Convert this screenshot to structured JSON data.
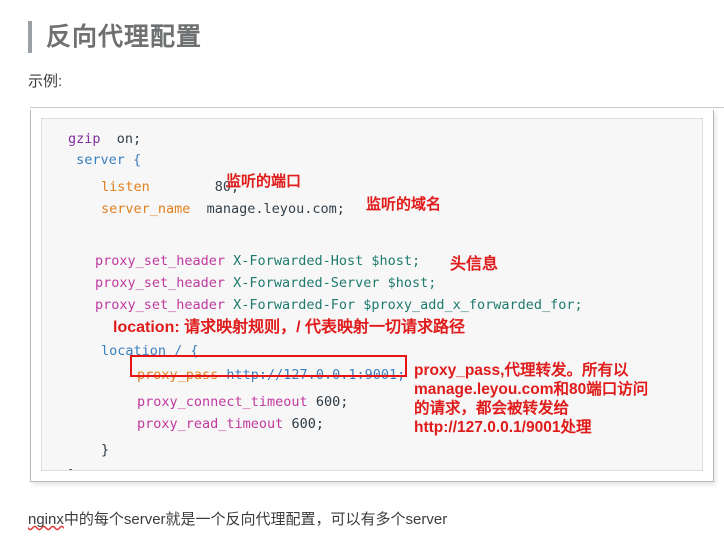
{
  "page": {
    "title": "反向代理配置",
    "example_label": "示例:",
    "footer": {
      "misspelled_word": "nginx",
      "rest": "中的每个server就是一个反向代理配置，可以有多个server"
    }
  },
  "code_block": {
    "language": "nginx",
    "lines": [
      {
        "indent": 1,
        "tokens": [
          {
            "text": "gzip",
            "color": "purple"
          },
          {
            "text": "  on;",
            "color": "plain"
          }
        ]
      },
      {
        "indent": 1,
        "tokens": [
          {
            "text": " server {",
            "color": "blue"
          }
        ]
      },
      {
        "indent": 2,
        "tokens": [
          {
            "text": "listen",
            "color": "orange"
          },
          {
            "text": "        80;",
            "color": "plain"
          }
        ]
      },
      {
        "indent": 2,
        "tokens": [
          {
            "text": "server_name",
            "color": "orange"
          },
          {
            "text": "  manage.leyou.com;",
            "color": "plain"
          }
        ]
      },
      {
        "indent": 0,
        "tokens": []
      },
      {
        "indent": 2,
        "tokens": [
          {
            "text": "proxy_set_header",
            "color": "magenta"
          },
          {
            "text": " X-Forwarded-Host $host;",
            "color": "teal"
          }
        ]
      },
      {
        "indent": 2,
        "tokens": [
          {
            "text": "proxy_set_header",
            "color": "magenta"
          },
          {
            "text": " X-Forwarded-Server $host;",
            "color": "teal"
          }
        ]
      },
      {
        "indent": 2,
        "tokens": [
          {
            "text": "proxy_set_header",
            "color": "magenta"
          },
          {
            "text": " X-Forwarded-For $proxy_add_x_forwarded_for;",
            "color": "teal"
          }
        ]
      },
      {
        "indent": 2,
        "tokens": [
          {
            "text": "location / {",
            "color": "blue"
          }
        ]
      },
      {
        "indent": 3,
        "tokens": [
          {
            "text": "proxy_pass",
            "color": "orange"
          },
          {
            "text": " http://127.0.0.1:9001;",
            "color": "blue"
          }
        ]
      },
      {
        "indent": 3,
        "tokens": [
          {
            "text": "proxy_connect_timeout",
            "color": "magenta"
          },
          {
            "text": " 600;",
            "color": "dark"
          }
        ]
      },
      {
        "indent": 3,
        "tokens": [
          {
            "text": "proxy_read_timeout",
            "color": "magenta"
          },
          {
            "text": " 600;",
            "color": "dark"
          }
        ]
      },
      {
        "indent": 2,
        "tokens": [
          {
            "text": "}",
            "color": "dark"
          }
        ]
      },
      {
        "indent": 1,
        "tokens": [
          {
            "text": "}",
            "color": "dark"
          }
        ]
      }
    ],
    "raw_lines": [
      "gzip  on;",
      " server {",
      "     listen        80;",
      "     server_name  manage.leyou.com;",
      "",
      "     proxy_set_header X-Forwarded-Host $host;",
      "     proxy_set_header X-Forwarded-Server $host;",
      "     proxy_set_header X-Forwarded-For $proxy_add_x_forwarded_for;",
      "     location / {",
      "         proxy_pass http://127.0.0.1:9001;",
      "         proxy_connect_timeout 600;",
      "         proxy_read_timeout 600;",
      "     }",
      " }"
    ]
  },
  "annotations": {
    "listen_port": "监听的端口",
    "server_name": "监听的域名",
    "headers": "头信息",
    "location": "location: 请求映射规则，/ 代表映射一切请求路径",
    "proxy_pass": {
      "line1": "proxy_pass,代理转发。所有以",
      "line2": "manage.leyou.com和80端口访问",
      "line3": "的请求，都会被转发给",
      "line4": "http://127.0.0.1/9001处理"
    }
  },
  "colors": {
    "annotation_red": "#e01b1b",
    "highlight_box_red": "#e81414",
    "title_gray": "#6e7072",
    "title_bar_gray": "#9aa0a6",
    "code_bg": "#f7f7f7",
    "keyword_purple": "#7f2f9e",
    "keyword_blue": "#3b7fbf",
    "keyword_orange": "#e08020",
    "keyword_magenta": "#c0399f",
    "keyword_teal": "#1f7a6e"
  }
}
